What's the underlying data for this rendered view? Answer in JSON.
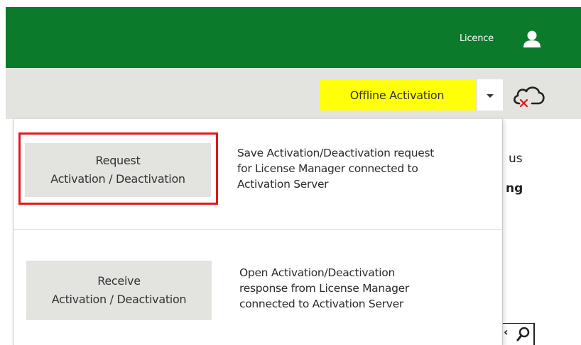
{
  "header": {
    "licence_label": "Licence",
    "user_icon": "user-icon",
    "background_color": "#0b7a2b"
  },
  "toolbar": {
    "activation_button_label": "Offline Activation",
    "activation_button_color": "#ffff0a",
    "dropdown_icon": "caret-down-icon",
    "cloud_icon": "cloud-disconnected-icon",
    "background_color": "#e3e3e0"
  },
  "dropdown_menu": {
    "items": [
      {
        "button_line1": "Request",
        "button_line2": "Activation / Deactivation",
        "description_line1": "Save Activation/Deactivation request",
        "description_line2": "for License Manager connected to",
        "description_line3": "Activation Server",
        "highlighted": true
      },
      {
        "button_line1": "Receive",
        "button_line2": "Activation / Deactivation",
        "description_line1": "Open Activation/Deactivation",
        "description_line2": "response from License Manager",
        "description_line3": "connected to Activation Server",
        "highlighted": false
      }
    ],
    "highlight_color": "#e4171b"
  },
  "background": {
    "fragment_1": "us",
    "fragment_2": "ng",
    "search_icon": "search-icon"
  }
}
